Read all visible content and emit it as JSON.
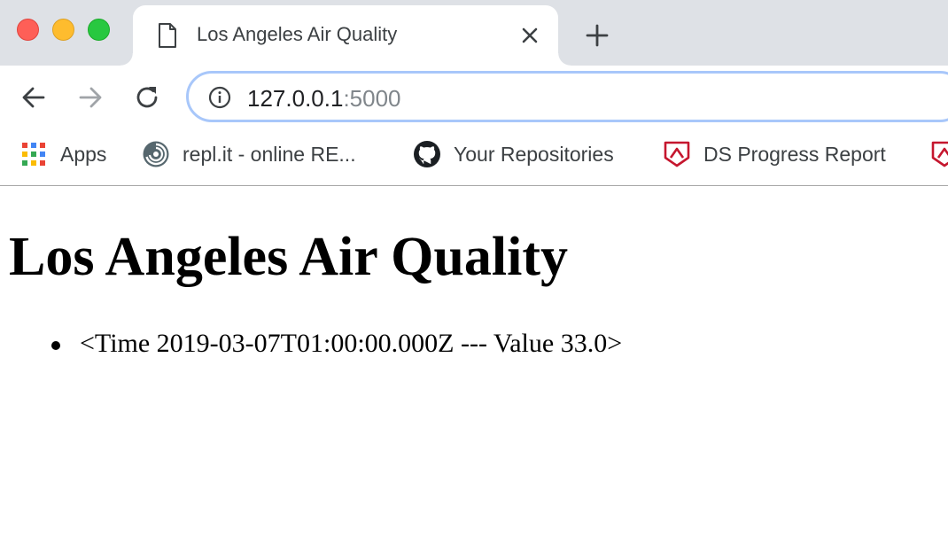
{
  "window": {
    "traffic_lights": [
      "close",
      "minimize",
      "maximize"
    ]
  },
  "tab": {
    "title": "Los Angeles Air Quality",
    "favicon": "document-icon",
    "close_icon": "close-icon"
  },
  "new_tab_icon": "plus-icon",
  "toolbar": {
    "back_icon": "arrow-left-icon",
    "forward_icon": "arrow-right-icon",
    "reload_icon": "reload-icon",
    "info_icon": "info-icon",
    "url_host": "127.0.0.1",
    "url_port": ":5000"
  },
  "bookmarks": {
    "items": [
      {
        "label": "Apps",
        "icon": "apps-grid-icon"
      },
      {
        "label": "repl.it - online RE...",
        "icon": "replit-icon"
      },
      {
        "label": "Your Repositories",
        "icon": "github-icon"
      },
      {
        "label": "DS Progress Report",
        "icon": "shield-icon"
      },
      {
        "label": "",
        "icon": "shield-icon"
      }
    ]
  },
  "page": {
    "title": "Los Angeles Air Quality",
    "readings": [
      {
        "text": "<Time 2019-03-07T01:00:00.000Z --- Value 33.0>"
      }
    ]
  },
  "colors": {
    "tabstrip_bg": "#dee1e6",
    "omnibox_border": "#a8c7fa",
    "shield_red": "#c5162e"
  }
}
